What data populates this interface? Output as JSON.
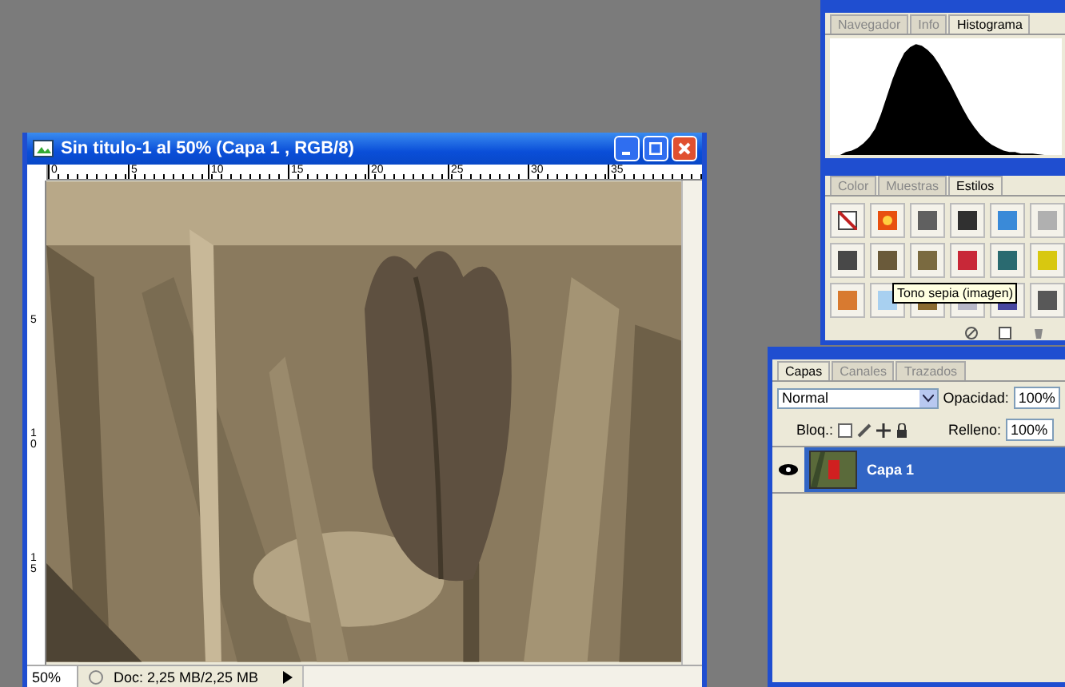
{
  "document_window": {
    "title": "Sin titulo-1 al 50% (Capa 1 , RGB/8)",
    "top_ruler": [
      "0",
      "5",
      "10",
      "15",
      "20",
      "25",
      "30",
      "35"
    ],
    "left_ruler": [
      "5",
      "10",
      "15"
    ],
    "status_bar": {
      "zoom": "50%",
      "doc_size": "Doc: 2,25 MB/2,25 MB"
    }
  },
  "histogram_panel": {
    "tabs": [
      {
        "label": "Navegador",
        "selected": false
      },
      {
        "label": "Info",
        "selected": false
      },
      {
        "label": "Histograma",
        "selected": true
      }
    ]
  },
  "styles_panel": {
    "tabs": [
      {
        "label": "Color",
        "selected": false
      },
      {
        "label": "Muestras",
        "selected": false
      },
      {
        "label": "Estilos",
        "selected": true
      }
    ],
    "styles": [
      {
        "kind": "none",
        "color": "#ffffff"
      },
      {
        "kind": "glow",
        "color": "#e85010"
      },
      {
        "kind": "plain",
        "color": "#606060"
      },
      {
        "kind": "plain",
        "color": "#303030"
      },
      {
        "kind": "plain",
        "color": "#3a8ad8"
      },
      {
        "kind": "plain",
        "color": "#b0b0b0"
      },
      {
        "kind": "plain",
        "color": "#484848"
      },
      {
        "kind": "plain",
        "color": "#6a5a3a"
      },
      {
        "kind": "plain",
        "color": "#7a6a40"
      },
      {
        "kind": "plain",
        "color": "#c82838"
      },
      {
        "kind": "plain",
        "color": "#2a6a70"
      },
      {
        "kind": "plain",
        "color": "#d8c810"
      },
      {
        "kind": "plain",
        "color": "#d87a30"
      },
      {
        "kind": "plain",
        "color": "#a8d0f0"
      },
      {
        "kind": "plain",
        "color": "#8a6a30"
      },
      {
        "kind": "plain",
        "color": "#b8b8c8"
      },
      {
        "kind": "plain",
        "color": "#4848a0"
      },
      {
        "kind": "plain",
        "color": "#585858"
      }
    ],
    "tooltip": "Tono sepia (imagen)"
  },
  "layers_panel": {
    "tabs": [
      {
        "label": "Capas",
        "selected": true
      },
      {
        "label": "Canales",
        "selected": false
      },
      {
        "label": "Trazados",
        "selected": false
      }
    ],
    "blend_mode": "Normal",
    "opacity_label": "Opacidad:",
    "opacity": "100%",
    "lock_label": "Bloq.:",
    "fill_label": "Relleno:",
    "fill": "100%",
    "layers": [
      {
        "name": "Capa 1",
        "selected": true,
        "visible": true
      }
    ]
  }
}
